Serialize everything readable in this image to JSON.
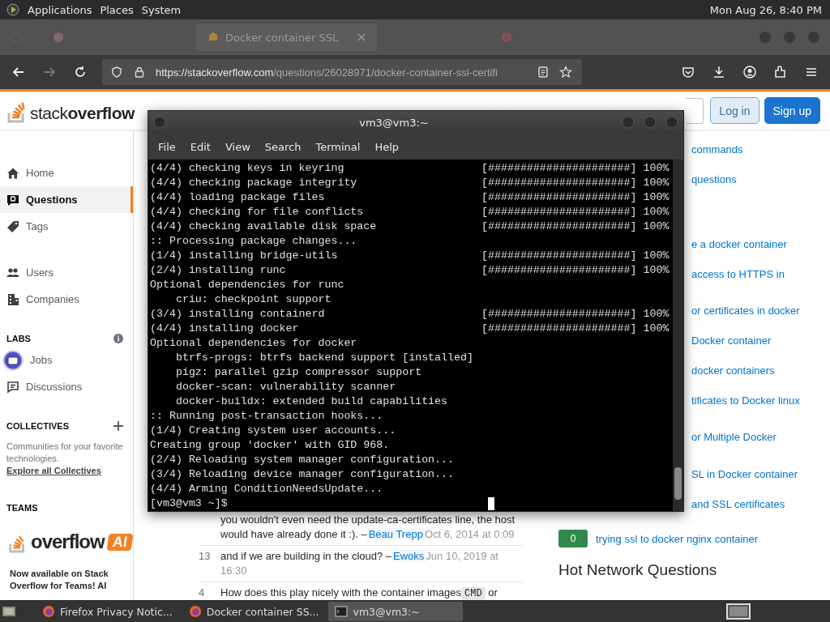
{
  "top_panel": {
    "menus": [
      "Applications",
      "Places",
      "System"
    ],
    "clock": "Mon Aug 26, 8:40 PM"
  },
  "browser": {
    "tabs": [
      {
        "title": "Docker container SSL",
        "selected": true
      }
    ],
    "url_host": "https://stackoverflow.com",
    "url_path": "/questions/26028971/docker-container-ssl-certifi"
  },
  "site_header": {
    "logo_light": "stack",
    "logo_bold": "overflow",
    "login": "Log in",
    "signup": "Sign up"
  },
  "sidebar": {
    "items": [
      {
        "label": "Home",
        "selected": false
      },
      {
        "label": "Questions",
        "selected": true
      },
      {
        "label": "Tags",
        "selected": false
      },
      {
        "label": "Users",
        "selected": false
      },
      {
        "label": "Companies",
        "selected": false
      }
    ],
    "labs_heading": "LABS",
    "labs_items": [
      {
        "label": "Jobs",
        "highlighted": true
      },
      {
        "label": "Discussions",
        "highlighted": false
      }
    ],
    "collectives_heading": "COLLECTIVES",
    "collectives_text": "Communities for your favorite technologies.",
    "collectives_link": "Explore all Collectives",
    "teams_heading": "TEAMS",
    "teams_logo": "overflow",
    "teams_badge": "AI",
    "teams_text": "Now available on Stack Overflow for Teams! AI"
  },
  "comments": [
    {
      "text": "you wouldn't even need the update-ca-certificates line, the host would have already done it :). –",
      "user": "Beau Trepp",
      "date": "Oct 6, 2014 at 0:09"
    },
    {
      "votes": "13",
      "text": "and if we are building in the cloud? –",
      "user": "Ewoks",
      "date": "Jun 10, 2019 at 16:30"
    },
    {
      "votes": "4",
      "text": "How does this play nicely with the container images",
      "code": "CMD",
      "after": "or"
    }
  ],
  "related": {
    "links": [
      "commands",
      "questions",
      "e a docker container",
      "access to HTTPS in",
      "or certificates in docker",
      "Docker container",
      "docker containers",
      "tificates to Docker linux",
      "or Multiple Docker",
      "SL in Docker container",
      "and SSL certificates"
    ],
    "scored": [
      {
        "score": "0",
        "title": "trying ssl to docker nginx container"
      }
    ],
    "hot_heading": "Hot Network Questions"
  },
  "terminal": {
    "title": "vm3@vm3:~",
    "menus": [
      "File",
      "Edit",
      "View",
      "Search",
      "Terminal",
      "Help"
    ],
    "lines": [
      {
        "text": "(4/4) checking keys in keyring",
        "progress": "[######################] 100%"
      },
      {
        "text": "(4/4) checking package integrity",
        "progress": "[######################] 100%"
      },
      {
        "text": "(4/4) loading package files",
        "progress": "[######################] 100%"
      },
      {
        "text": "(4/4) checking for file conflicts",
        "progress": "[######################] 100%"
      },
      {
        "text": "(4/4) checking available disk space",
        "progress": "[######################] 100%"
      },
      {
        "text": ":: Processing package changes..."
      },
      {
        "text": "(1/4) installing bridge-utils",
        "progress": "[######################] 100%"
      },
      {
        "text": "(2/4) installing runc",
        "progress": "[######################] 100%"
      },
      {
        "text": "Optional dependencies for runc"
      },
      {
        "text": "    criu: checkpoint support"
      },
      {
        "text": "(3/4) installing containerd",
        "progress": "[######################] 100%"
      },
      {
        "text": "(4/4) installing docker",
        "progress": "[######################] 100%"
      },
      {
        "text": "Optional dependencies for docker"
      },
      {
        "text": "    btrfs-progs: btrfs backend support [installed]"
      },
      {
        "text": "    pigz: parallel gzip compressor support"
      },
      {
        "text": "    docker-scan: vulnerability scanner"
      },
      {
        "text": "    docker-buildx: extended build capabilities"
      },
      {
        "text": ":: Running post-transaction hooks..."
      },
      {
        "text": "(1/4) Creating system user accounts..."
      },
      {
        "text": "Creating group 'docker' with GID 968."
      },
      {
        "text": "(2/4) Reloading system manager configuration..."
      },
      {
        "text": "(3/4) Reloading device manager configuration..."
      },
      {
        "text": "(4/4) Arming ConditionNeedsUpdate..."
      }
    ],
    "prompt": "[vm3@vm3 ~]$"
  },
  "taskbar": {
    "items": [
      {
        "title": "Firefox Privacy Notic...",
        "selected": false
      },
      {
        "title": "Docker container SS...",
        "selected": false
      },
      {
        "title": "vm3@vm3:~",
        "selected": true
      }
    ]
  }
}
